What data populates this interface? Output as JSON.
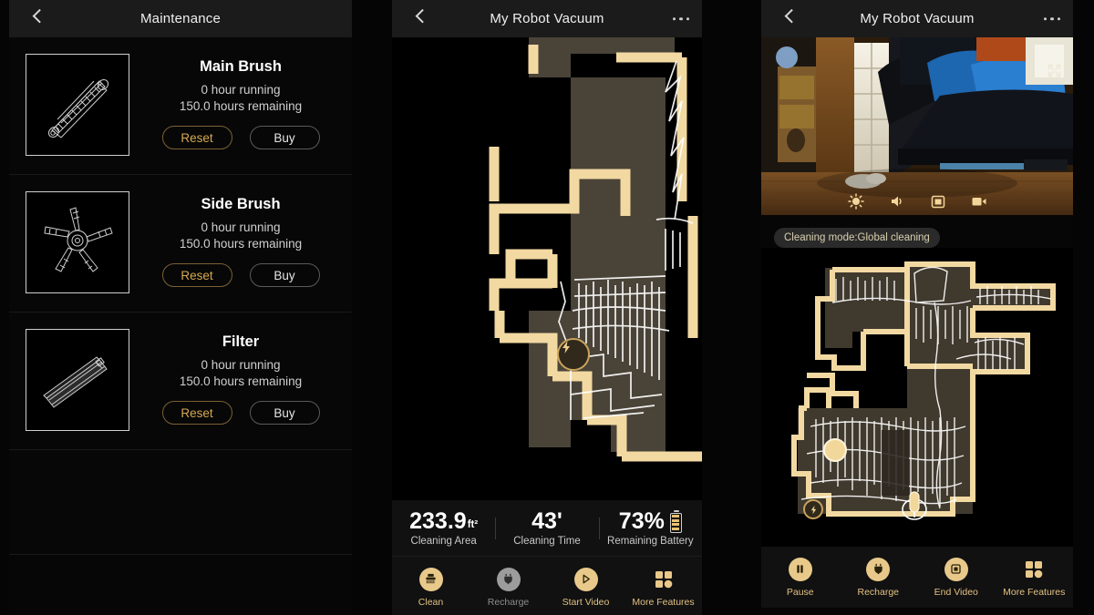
{
  "colors": {
    "gold": "#e8c98a",
    "wall": "#f2d9a2",
    "floor": "#4a4338",
    "path": "#ffffff",
    "reset_text": "#d6a94f",
    "panel_bg": "#070707",
    "appbar_bg": "#1b1b1b"
  },
  "maintenance_panel": {
    "appbar": {
      "title": "Maintenance",
      "back_icon": "chevron-left-icon"
    },
    "items": [
      {
        "name": "Main Brush",
        "thumb_icon": "main-brush-illustration",
        "running": "0 hour running",
        "remaining": "150.0 hours remaining",
        "reset_label": "Reset",
        "buy_label": "Buy"
      },
      {
        "name": "Side Brush",
        "thumb_icon": "side-brush-illustration",
        "running": "0 hour running",
        "remaining": "150.0 hours remaining",
        "reset_label": "Reset",
        "buy_label": "Buy"
      },
      {
        "name": "Filter",
        "thumb_icon": "filter-illustration",
        "running": "0 hour running",
        "remaining": "150.0 hours remaining",
        "reset_label": "Reset",
        "buy_label": "Buy"
      }
    ]
  },
  "map_panel": {
    "appbar": {
      "title": "My Robot Vacuum",
      "back_icon": "chevron-left-icon",
      "more_icon": "more-horizontal-icon"
    },
    "map": {
      "dock_icon": "charging-dock-bolt-icon",
      "zoom_state": "zoomed-in"
    },
    "stats": [
      {
        "value": "233.9",
        "unit": "ft²",
        "label": "Cleaning Area"
      },
      {
        "value": "43'",
        "unit": "",
        "label": "Cleaning Time"
      },
      {
        "value": "73%",
        "unit": "",
        "label": "Remaining Battery",
        "icon": "battery-icon",
        "battery_level": 73
      }
    ],
    "toolbar": [
      {
        "label": "Clean",
        "icon": "brush-clean-icon",
        "style": "gold"
      },
      {
        "label": "Recharge",
        "icon": "dock-recharge-icon",
        "style": "grey"
      },
      {
        "label": "Start Video",
        "icon": "play-icon",
        "style": "gold"
      },
      {
        "label": "More Features",
        "icon": "grid-more-icon",
        "style": "gold"
      }
    ]
  },
  "video_panel": {
    "appbar": {
      "title": "My Robot Vacuum",
      "back_icon": "chevron-left-icon",
      "more_icon": "more-horizontal-icon"
    },
    "video": {
      "expand_icon": "expand-fullscreen-icon",
      "controls": [
        {
          "icon": "brightness-icon"
        },
        {
          "icon": "speaker-volume-icon"
        },
        {
          "icon": "screenshot-capture-icon"
        },
        {
          "icon": "video-record-icon"
        }
      ]
    },
    "mode_badge": "Cleaning mode:Global cleaning",
    "map": {
      "dock_icon": "charging-dock-bolt-icon",
      "robot_icon": "robot-position-icon",
      "zoom_state": "full-map"
    },
    "toolbar": [
      {
        "label": "Pause",
        "icon": "pause-icon",
        "style": "gold"
      },
      {
        "label": "Recharge",
        "icon": "dock-recharge-icon",
        "style": "gold"
      },
      {
        "label": "End Video",
        "icon": "stop-video-icon",
        "style": "gold"
      },
      {
        "label": "More Features",
        "icon": "grid-more-icon",
        "style": "gold"
      }
    ]
  }
}
